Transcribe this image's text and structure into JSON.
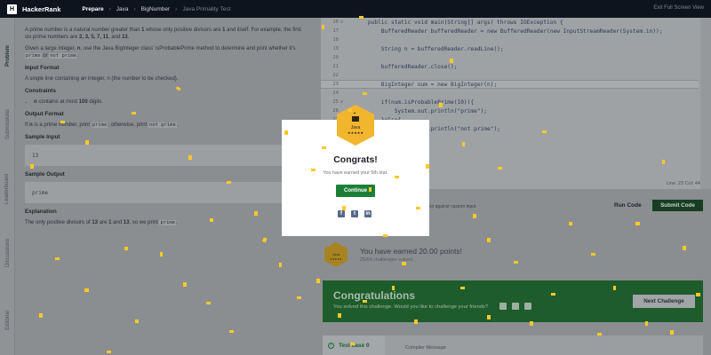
{
  "topbar": {
    "logo_letter": "H",
    "brand": "HackerRank",
    "breadcrumbs": [
      "Prepare",
      "Java",
      "BigNumber",
      "Java Primality Test"
    ],
    "exit_label": "Exit Full Screen View"
  },
  "left_tabs": [
    "Problem",
    "Submissions",
    "Leaderboard",
    "Discussions",
    "Editorial"
  ],
  "problem": {
    "intro_1a": "A prime number is a natural number greater than ",
    "intro_1b": "1",
    "intro_1c": " whose only positive divisors are ",
    "intro_1d": "1",
    "intro_1e": " and itself. For example, the first six prime numbers are ",
    "intro_primes": "2, 3, 5, 7, 11",
    "intro_1f": ", and ",
    "intro_1g": "13",
    "intro_1h": ".",
    "intro_2a": "Given a large integer, ",
    "intro_2b": "n",
    "intro_2c": ", use the Java BigInteger class' ",
    "intro_2d": "isProbablePrime",
    "intro_2e": " method to determine and print whether it's ",
    "intro_2f": "prime",
    "intro_2g": " or ",
    "intro_2h": "not prime",
    "intro_2i": ".",
    "input_format_title": "Input Format",
    "input_format_text": "A single line containing an integer, n (the number to be checked).",
    "constraints_title": "Constraints",
    "constraint_a": "n",
    "constraint_b": " contains at most ",
    "constraint_c": "100",
    "constraint_d": " digits.",
    "output_format_title": "Output Format",
    "output_a": "If ",
    "output_b": "n",
    "output_c": " is a prime number, print ",
    "output_d": "prime",
    "output_e": "; otherwise, print ",
    "output_f": "not prime",
    "output_g": ".",
    "sample_input_title": "Sample Input",
    "sample_input_value": "13",
    "sample_output_title": "Sample Output",
    "sample_output_value": "prime",
    "explanation_title": "Explanation",
    "expl_a": "The only positive divisors of ",
    "expl_b": "13",
    "expl_c": " are ",
    "expl_d": "1",
    "expl_e": " and ",
    "expl_f": "13",
    "expl_g": ", so we print ",
    "expl_h": "prime",
    "expl_i": "."
  },
  "editor": {
    "lines": [
      {
        "num": "16",
        "fold": "v",
        "code": "    public static void main(String[] args) throws IOException {"
      },
      {
        "num": "17",
        "fold": "",
        "code": "        BufferedReader bufferedReader = new BufferedReader(new InputStreamReader(System.in));"
      },
      {
        "num": "18",
        "fold": "",
        "code": ""
      },
      {
        "num": "19",
        "fold": "",
        "code": "        String n = bufferedReader.readLine();"
      },
      {
        "num": "20",
        "fold": "",
        "code": ""
      },
      {
        "num": "21",
        "fold": "",
        "code": "        bufferedReader.close();"
      },
      {
        "num": "22",
        "fold": "",
        "code": ""
      },
      {
        "num": "23",
        "fold": "",
        "code": "        BigInteger num = new BigInteger(n);"
      },
      {
        "num": "24",
        "fold": "",
        "code": ""
      },
      {
        "num": "25",
        "fold": "v",
        "code": "        if(num.isProbablePrime(10)){"
      },
      {
        "num": "26",
        "fold": "",
        "code": "            System.out.println(\"prime\");"
      },
      {
        "num": "27",
        "fold": "v",
        "code": "        }else{"
      },
      {
        "num": "28",
        "fold": "",
        "code": "            System.out.println(\"not prime\");"
      },
      {
        "num": "29",
        "fold": "",
        "code": "        }"
      }
    ],
    "line_col": "Line: 23 Col: 44"
  },
  "actions": {
    "custom_input": "Test against custom input",
    "run_label": "Run Code",
    "submit_label": "Submit Code"
  },
  "badge_small_label": "Java",
  "badge_small_stars": "★★★★★",
  "earned_text": "You have earned 20.00 points!",
  "solved_text": "25/64 challenges solved.",
  "congrats_bar": {
    "title": "Congratulations",
    "subtitle": "You solved this challenge. Would you like to challenge your friends?",
    "next_label": "Next Challenge"
  },
  "test_case": {
    "label": "Test case 0",
    "compiler_label": "Compiler Message"
  },
  "modal": {
    "badge_label": "Java",
    "badge_stars": "★★★★★",
    "title": "Congrats!",
    "subtitle": "You have earned your 5th star.",
    "button": "Continue",
    "share_icons": [
      "f",
      "t",
      "in"
    ]
  },
  "colors": {
    "accent_green": "#1c7f37",
    "badge_gold": "#f2b52e",
    "confetti_gold": "#ffc928"
  }
}
